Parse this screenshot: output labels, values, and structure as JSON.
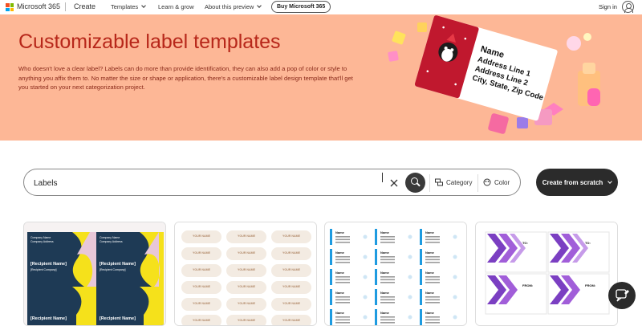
{
  "header": {
    "brand": "Microsoft 365",
    "create": "Create",
    "nav": [
      {
        "label": "Templates",
        "has_dropdown": true
      },
      {
        "label": "Learn & grow",
        "has_dropdown": false
      },
      {
        "label": "About this preview",
        "has_dropdown": true
      }
    ],
    "buy": "Buy Microsoft 365",
    "signin": "Sign in",
    "logo_colors": [
      "#f25022",
      "#7fba00",
      "#00a4ef",
      "#ffb900"
    ]
  },
  "hero": {
    "title": "Customizable label templates",
    "description": "Who doesn't love a clear label? Labels can do more than provide identification, they can also add a pop of color or style to anything you affix them to. No matter the size or shape or application, there's a customizable label design template that'll get you started on your next categorization project.",
    "label_preview": [
      "Name",
      "Address Line 1",
      "Address Line 2",
      "City, State, Zip Code"
    ],
    "background": "#fdb796",
    "title_color": "#b7271a"
  },
  "search": {
    "value": "Labels",
    "category": "Category",
    "color": "Color",
    "create_from_scratch": "Create from scratch"
  },
  "cards": [
    {
      "name": "card-1",
      "theme": "navy-yellow",
      "labels": [
        "[Recipient Name]",
        "[Recipient Name]"
      ],
      "sender": "Company Name\nCompany Address\nCity, ST Postal Code"
    },
    {
      "name": "card-2",
      "theme": "beige-ovals",
      "labels": [
        "YOUR NAME",
        "YOUR NAME",
        "YOUR NAME"
      ]
    },
    {
      "name": "card-3",
      "theme": "blue-strips",
      "labels": [
        "Name",
        "Name"
      ]
    },
    {
      "name": "card-4",
      "theme": "purple-chevrons",
      "labels": [
        "TO:",
        "TO:",
        "FROM:",
        "FROM:"
      ]
    }
  ]
}
